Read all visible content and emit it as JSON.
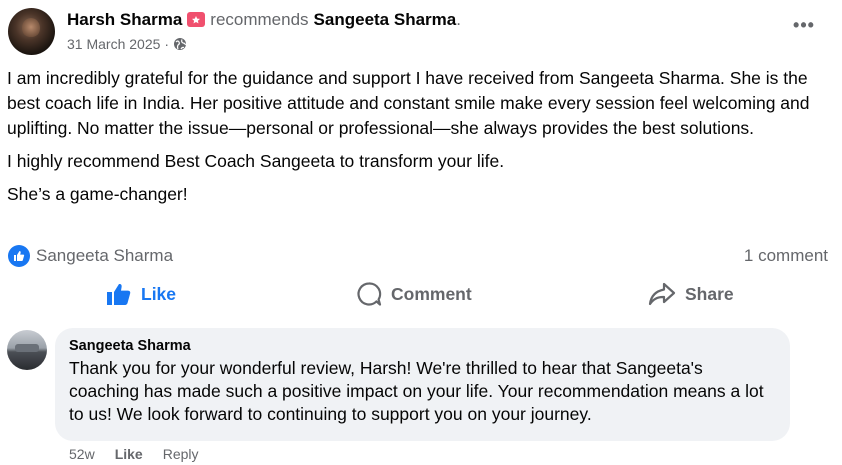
{
  "post": {
    "author": "Harsh Sharma",
    "recommends_text": "recommends",
    "target": "Sangeeta Sharma",
    "period": ".",
    "date": "31 March 2025",
    "meta_sep": "·",
    "more_label": "•••",
    "paragraphs": [
      "I am incredibly grateful for the guidance and support I have received from Sangeeta Sharma. She is the best coach life in India. Her positive attitude and constant smile make every session feel welcoming and uplifting. No matter the issue—personal or professional—she always provides the best solutions.",
      "I highly recommend Best Coach Sangeeta to transform your life.",
      "She’s a game-changer!"
    ]
  },
  "reactions": {
    "liked_by": "Sangeeta Sharma",
    "comment_count": "1 comment"
  },
  "actions": {
    "like": "Like",
    "comment": "Comment",
    "share": "Share"
  },
  "comment": {
    "author": "Sangeeta Sharma",
    "text": "Thank you for your wonderful review, Harsh! We're thrilled to hear that Sangeeta's coaching has made such a positive impact on your life. Your recommendation means a lot to us! We look forward to continuing to support you on your journey.",
    "age": "52w",
    "like_label": "Like",
    "reply_label": "Reply"
  },
  "colors": {
    "accent": "#1877f2",
    "muted": "#65676b",
    "bubble": "#f0f2f5",
    "recommend_badge": "#f0506e"
  },
  "icons": {
    "recommend": "recommend-flag-icon",
    "globe": "globe-icon",
    "like_badge": "thumbs-up-badge-icon",
    "like": "thumbs-up-icon",
    "comment": "comment-bubble-icon",
    "share": "share-arrow-icon"
  }
}
